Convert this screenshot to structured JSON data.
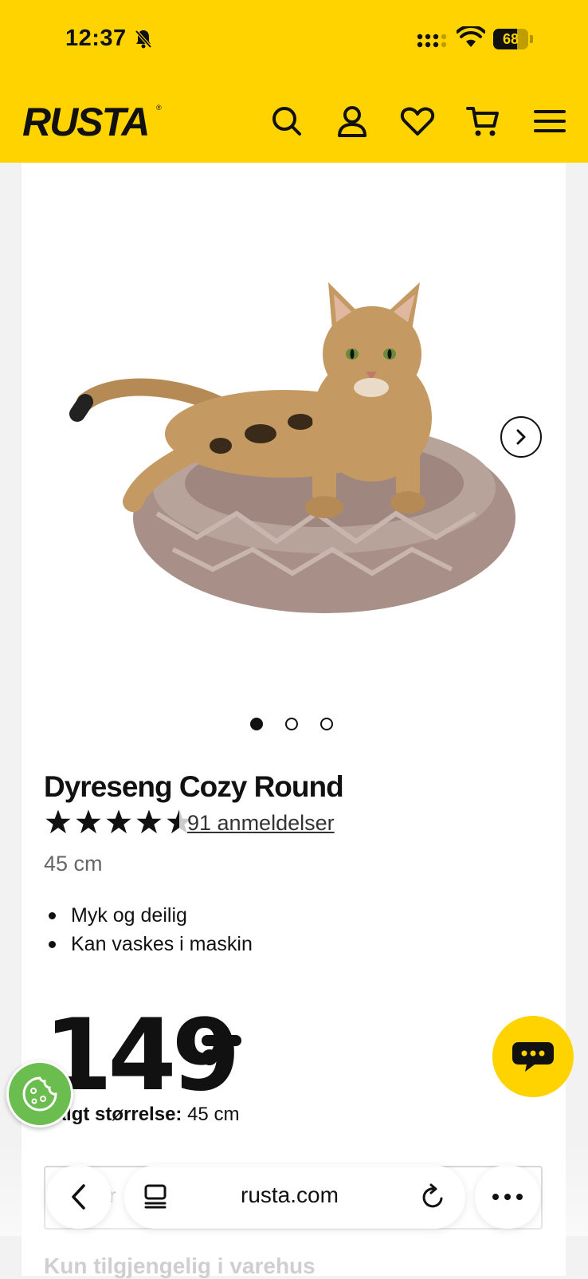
{
  "status_bar": {
    "time": "12:37",
    "battery": "68",
    "battery_level": 0.68,
    "icons": [
      "bell-slash-icon",
      "signal-icon",
      "wifi-icon",
      "battery-icon"
    ]
  },
  "header": {
    "logo": "RUSTA",
    "brand_color": "#ffd300",
    "icons": [
      "search-icon",
      "user-icon",
      "heart-icon",
      "cart-icon",
      "menu-icon"
    ]
  },
  "gallery": {
    "image_alt": "cat-on-round-bed",
    "slide_count": 3,
    "active_slide": 1,
    "next_icon": "chevron-right-icon"
  },
  "product": {
    "title": "Dyreseng Cozy Round",
    "rating": 4.5,
    "rating_max": 5,
    "reviews_label": "91 anmeldelser",
    "size": "45 cm",
    "bullets": [
      "Myk og deilig",
      "Kan vaskes i maskin"
    ],
    "price": "149",
    "selected_size_label": "Valgt størrelse:",
    "selected_size_value": "45 cm",
    "store_availability": "Kun tilgjengelig i varehus"
  },
  "floating": {
    "cookie_icon": "cookie-icon",
    "chat_icon": "chat-icon"
  },
  "browser": {
    "url": "rusta.com",
    "icons": [
      "back-icon",
      "tabs-icon",
      "reload-icon",
      "more-icon"
    ]
  }
}
